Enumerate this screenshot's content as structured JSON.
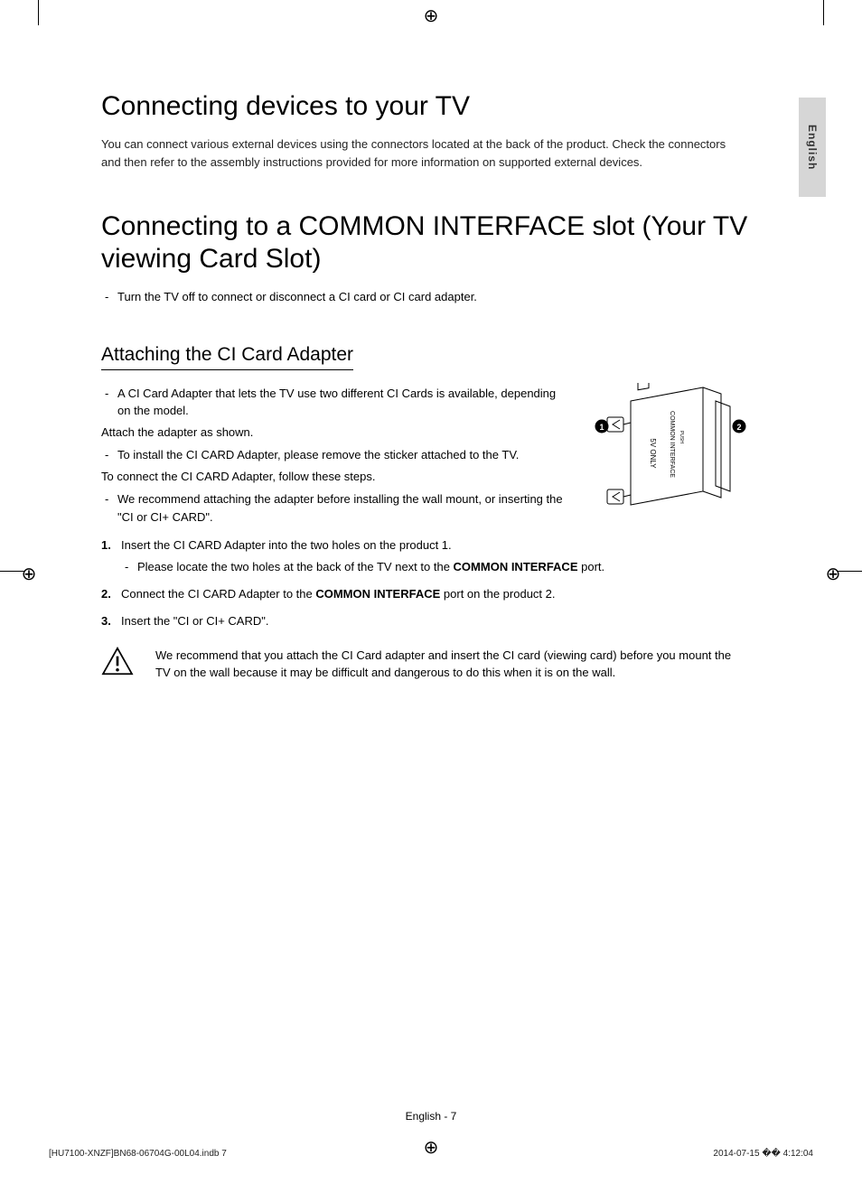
{
  "lang_tab": "English",
  "section1": {
    "heading": "Connecting devices to your TV",
    "intro": "You can connect various external devices using the connectors located at the back of the product. Check the connectors and then refer to the assembly instructions provided for more information on supported external devices."
  },
  "section2": {
    "heading": "Connecting to a COMMON INTERFACE slot (Your TV viewing Card Slot)",
    "bullets": [
      "Turn the TV off to connect or disconnect a CI card or CI card adapter."
    ]
  },
  "section3": {
    "subheading": "Attaching the CI Card Adapter",
    "bullets1": [
      "A CI Card Adapter that lets the TV use two different CI Cards is available, depending on the model."
    ],
    "plain1": "Attach the adapter as shown.",
    "bullets2": [
      "To install the CI CARD Adapter, please remove the sticker attached to the TV."
    ],
    "plain2": "To connect the CI CARD Adapter, follow these steps.",
    "bullets3": [
      "We recommend attaching the adapter before installing the wall mount, or inserting the \"CI or CI+ CARD\"."
    ],
    "steps": [
      {
        "text_pre": "Insert the CI CARD Adapter into the two holes on the product 1.",
        "sub": [
          "Please locate the two holes at the back of the TV next to the "
        ],
        "sub_bold": "COMMON INTERFACE",
        "sub_post": " port."
      },
      {
        "text_pre": "Connect the CI CARD Adapter to the ",
        "bold": "COMMON INTERFACE",
        "text_post": " port on the product 2."
      },
      {
        "text_pre": "Insert the \"CI or CI+ CARD\"."
      }
    ],
    "warning": "We recommend that you attach the CI Card adapter and insert the CI card (viewing card) before you mount the TV on the wall because it may be difficult and dangerous to do this when it is on the wall."
  },
  "diagram": {
    "label_5v": "5V ONLY",
    "label_push": "PUSH",
    "label_ci": "COMMON INTERFACE",
    "marker1": "1",
    "marker2": "2"
  },
  "footer": {
    "page": "English - 7",
    "print_left": "[HU7100-XNZF]BN68-06704G-00L04.indb   7",
    "print_right": "2014-07-15   �� 4:12:04"
  }
}
